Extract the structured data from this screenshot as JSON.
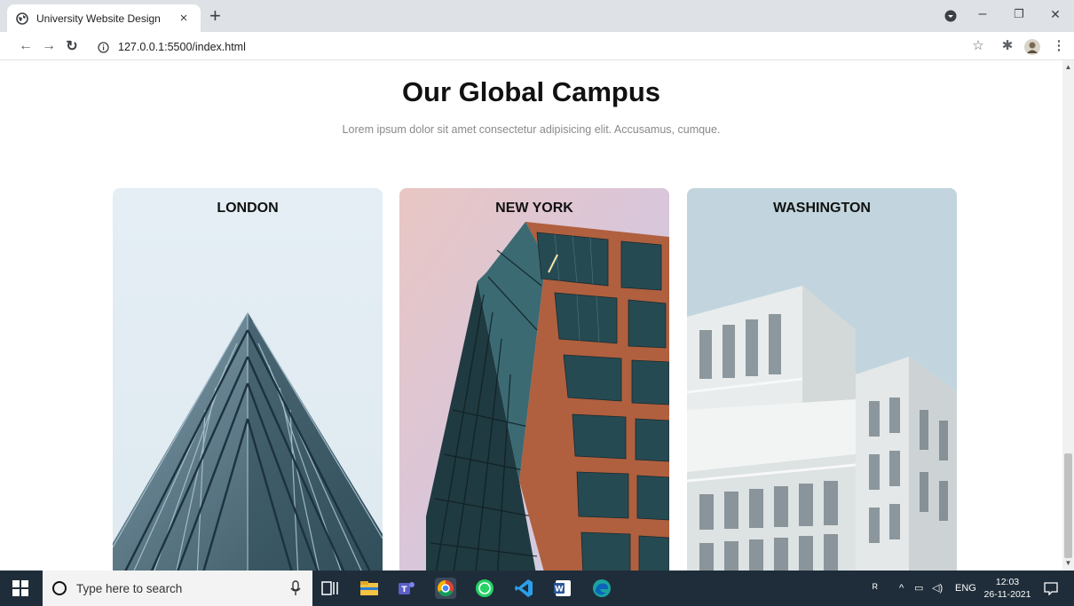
{
  "browser": {
    "tab_title": "University Website Design",
    "tab_close": "×",
    "new_tab": "+",
    "url": "127.0.0.1:5500/index.html",
    "win_minimize": "–",
    "win_restore": "❐",
    "win_close": "✕"
  },
  "section": {
    "title": "Our Global Campus",
    "subtitle": "Lorem ipsum dolor sit amet consectetur adipisicing elit. Accusamus, cumque."
  },
  "campuses": [
    {
      "name": "LONDON"
    },
    {
      "name": "NEW YORK"
    },
    {
      "name": "WASHINGTON"
    }
  ],
  "taskbar": {
    "search_placeholder": "Type here to search",
    "lang": "ENG",
    "time": "12:03",
    "date": "26-11-2021"
  },
  "colors": {
    "tabbar_bg": "#dee1e6",
    "taskbar_bg": "#1f2d3a",
    "brick": "#b0603f",
    "glass": "#2f5a63"
  }
}
